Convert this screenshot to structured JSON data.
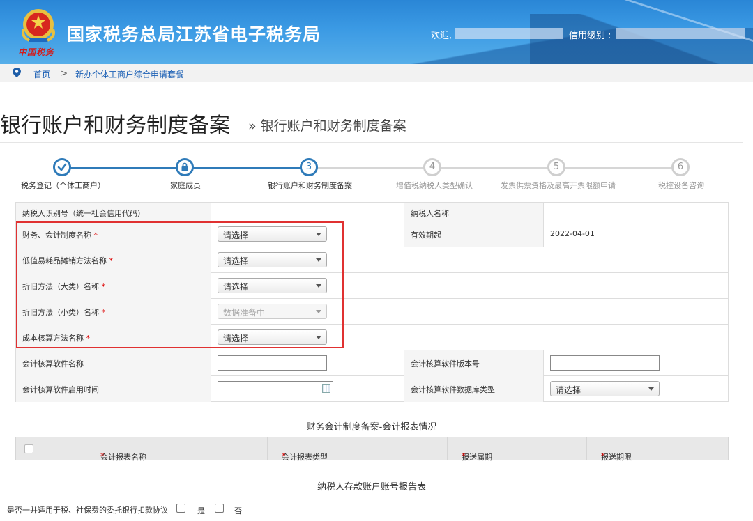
{
  "header": {
    "site_title": "国家税务总局江苏省电子税务局",
    "emblem_caption": "中国税务",
    "welcome_label": "欢迎,",
    "credit_label": "信用级别 :"
  },
  "breadcrumb": {
    "home": "首页",
    "separator": ">",
    "current": "新办个体工商户综合申请套餐"
  },
  "page": {
    "title": "银行账户和财务制度备案",
    "subtitle": "» 银行账户和财务制度备案"
  },
  "steps": [
    {
      "num": "✓",
      "label": "税务登记（个体工商户）",
      "state": "done"
    },
    {
      "num": "🔒",
      "label": "家庭成员",
      "state": "done"
    },
    {
      "num": "3",
      "label": "银行账户和财务制度备案",
      "state": "current"
    },
    {
      "num": "4",
      "label": "增值税纳税人类型确认",
      "state": "future"
    },
    {
      "num": "5",
      "label": "发票供票资格及最高开票限额申请",
      "state": "future"
    },
    {
      "num": "6",
      "label": "税控设备咨询",
      "state": "future"
    }
  ],
  "form": {
    "taxpayer_id_label": "纳税人识别号（统一社会信用代码）",
    "taxpayer_name_label": "纳税人名称",
    "accounting_system_label": "财务、会计制度名称",
    "accounting_system_value": "请选择",
    "valid_from_label": "有效期起",
    "valid_from_value": "2022-04-01",
    "low_value_label": "低值易耗品摊销方法名称",
    "low_value_value": "请选择",
    "depr_major_label": "折旧方法（大类）名称",
    "depr_major_value": "请选择",
    "depr_minor_label": "折旧方法（小类）名称",
    "depr_minor_value": "数据准备中",
    "cost_label": "成本核算方法名称",
    "cost_value": "请选择",
    "software_name_label": "会计核算软件名称",
    "software_version_label": "会计核算软件版本号",
    "software_start_label": "会计核算软件启用时间",
    "software_db_label": "会计核算软件数据库类型",
    "software_db_value": "请选择",
    "required_mark": "*"
  },
  "report_section": {
    "title": "财务会计制度备案-会计报表情况",
    "columns": [
      "会计报表名称",
      "会计报表类型",
      "报送属期",
      "报送期限"
    ]
  },
  "deposit_section": {
    "title": "纳税人存款账户账号报告表",
    "question": "是否一并适用于税、社保费的委托银行扣款协议",
    "yes": "是",
    "no": "否"
  }
}
